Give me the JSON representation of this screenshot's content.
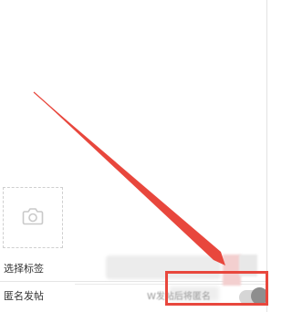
{
  "form": {
    "photo_upload": {
      "icon": "camera-icon"
    },
    "tags_row": {
      "label": "选择标签"
    },
    "anonymous_row": {
      "label": "匿名发帖",
      "hint": "W发帖后将匿名",
      "toggle_state": "off"
    }
  },
  "annotation": {
    "color": "#e8473d",
    "arrow_icon": "arrow-icon",
    "target": "anonymous-toggle"
  }
}
